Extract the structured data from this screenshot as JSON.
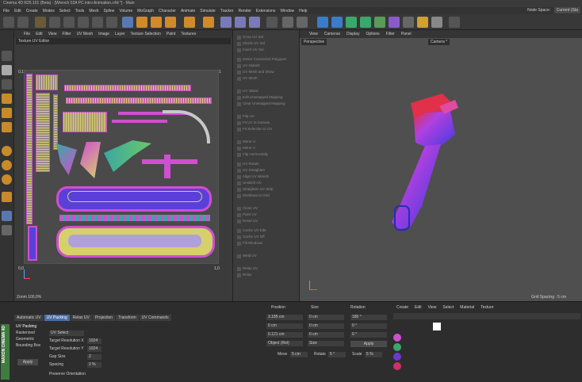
{
  "title": "Cinema 4D R25.101 (Beta) - [Wrench 02A PC intro Animation.c4d *] - Main",
  "menu": [
    "File",
    "Edit",
    "Create",
    "Modes",
    "Select",
    "Tools",
    "Mesh",
    "Spline",
    "Volume",
    "MoGraph",
    "Character",
    "Animate",
    "Simulate",
    "Tracker",
    "Render",
    "Extensions",
    "Window",
    "Help"
  ],
  "node_space_label": "Node Space:",
  "node_space_value": "Current (Sta",
  "uv_menu": [
    "File",
    "Edit",
    "View",
    "Filter",
    "UV Mesh",
    "Image",
    "Layer",
    "Texture Selection",
    "Paint",
    "Textures"
  ],
  "uv_editor_label": "Texture UV Editor",
  "uv_axis": {
    "v1": "0,1",
    "u1": "1,1",
    "origin": "0,0",
    "u_end": "1,0"
  },
  "zoom_label": "Zoom 100,0%",
  "uv_commands": [
    "Grow UV Sel.",
    "Shrink UV Sel.",
    "Invert UV Sel.",
    "Select Connected Polygons",
    "UV Islands",
    "UV Mesh and Show",
    "UV Mesh",
    "UV Island",
    "Edit Unwrapped Mapping",
    "Clear Unwrapped Mapping",
    "Flip UV",
    "Fit UV to Canvas",
    "Fit Selection to UV",
    "Mirror U",
    "Mirror V",
    "Flip Horizontally",
    "UV Rotate",
    "UV Straighten",
    "Align UV Islands",
    "Unstitch UV",
    "Straighten UV Strip",
    "Distribute to Grid",
    "Close UV",
    "Paint UV",
    "Reset UV",
    "Cache UV Edit",
    "Cache UV Off",
    "Fill Windows",
    "Weld UV",
    "Relax UV",
    "Relax"
  ],
  "viewport_menu": [
    "View",
    "Cameras",
    "Display",
    "Options",
    "Filter",
    "Panel"
  ],
  "viewport_label": "Perspective",
  "camera_label": "Camera *",
  "grid_spacing": "Grid Spacing : 5 cm",
  "tabs": [
    "Automatic UV",
    "UV Packing",
    "Relax UV",
    "Projection",
    "Transform",
    "UV Commands"
  ],
  "active_tab": "UV Packing",
  "uv_packing": {
    "section": "UV Packing",
    "options": [
      "Rasterized",
      "Geometric",
      "Bounding Box"
    ],
    "dropdown": "UV Select",
    "target_x_label": "Target Resolution X",
    "target_x_val": "1024",
    "target_y_label": "Target Resolution Y",
    "target_y_val": "1024",
    "gap_label": "Gap Size",
    "gap_val": "2",
    "spacing_label": "Spacing",
    "spacing_val": "2 %",
    "preserve": "Preserve Orientation",
    "apply": "Apply"
  },
  "coords": {
    "position": "Position",
    "size": "Size",
    "rotation": "Rotation",
    "x_pos": "3.185 cm",
    "y_pos": "0 cm",
    "z_pos": "0.121 cm",
    "x_size": "0 cm",
    "y_size": "0 cm",
    "z_size": "0 cm",
    "h_rot": "180 °",
    "p_rot": "0 °",
    "b_rot": "0 °",
    "obj_rel": "Object (Rel)",
    "size_mode": "Size",
    "apply": "Apply",
    "move_label": "Move",
    "move_val": "5 cm",
    "rotate_label": "Rotate",
    "rotate_val": "5 °",
    "scale_label": "Scale",
    "scale_val": "5 %"
  },
  "obj_menu": [
    "Create",
    "Edit",
    "View",
    "Select",
    "Material",
    "Texture"
  ],
  "logo": "MAXON CINEMA 4D",
  "colors": {
    "accent": "#4a6fa5",
    "uv_magenta": "#d04fd0",
    "uv_yellow": "#d6d06c",
    "uv_teal": "#3aa8a0",
    "wrench_blue": "#4a3ae0",
    "wrench_red": "#e0304a"
  }
}
